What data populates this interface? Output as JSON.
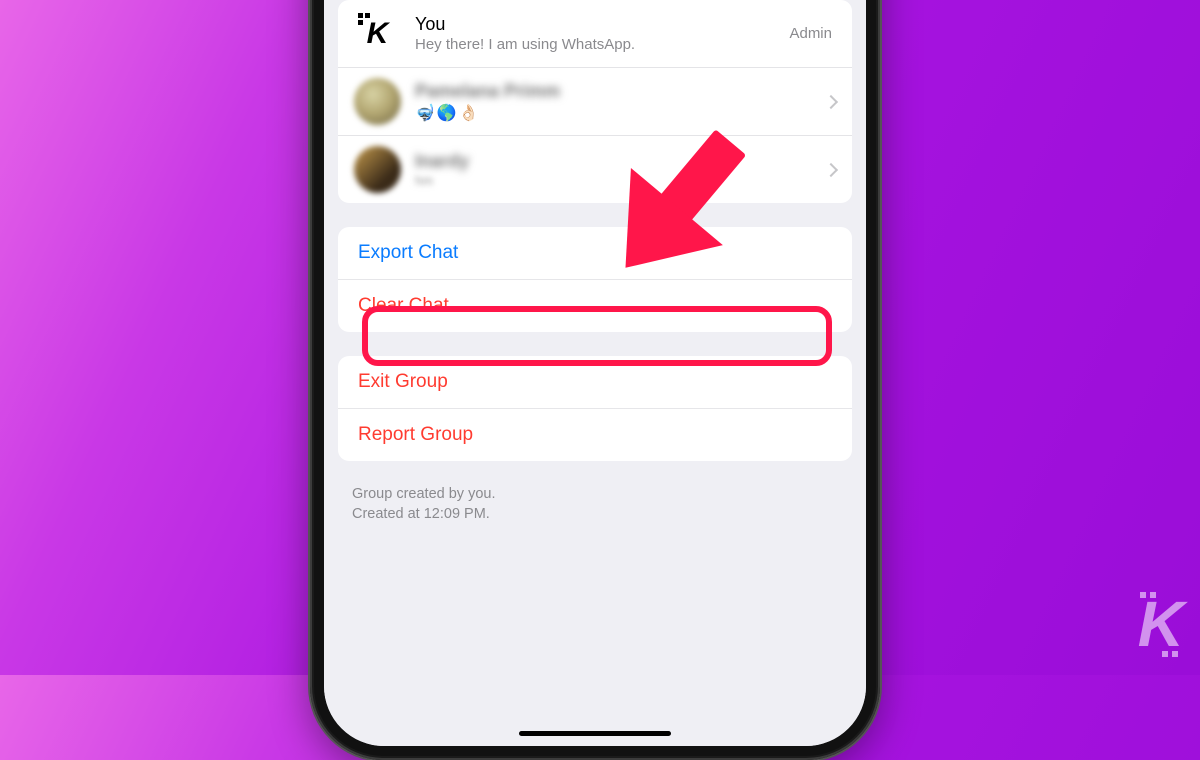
{
  "participants": {
    "you": {
      "name": "You",
      "status": "Hey there! I am using WhatsApp.",
      "role": "Admin"
    },
    "p2": {
      "emoji": "🤿🌎👌🏻"
    }
  },
  "actions": {
    "export": "Export Chat",
    "clear": "Clear Chat",
    "exit": "Exit Group",
    "report": "Report Group"
  },
  "meta": {
    "line1": "Group created by you.",
    "line2": "Created at 12:09 PM."
  }
}
